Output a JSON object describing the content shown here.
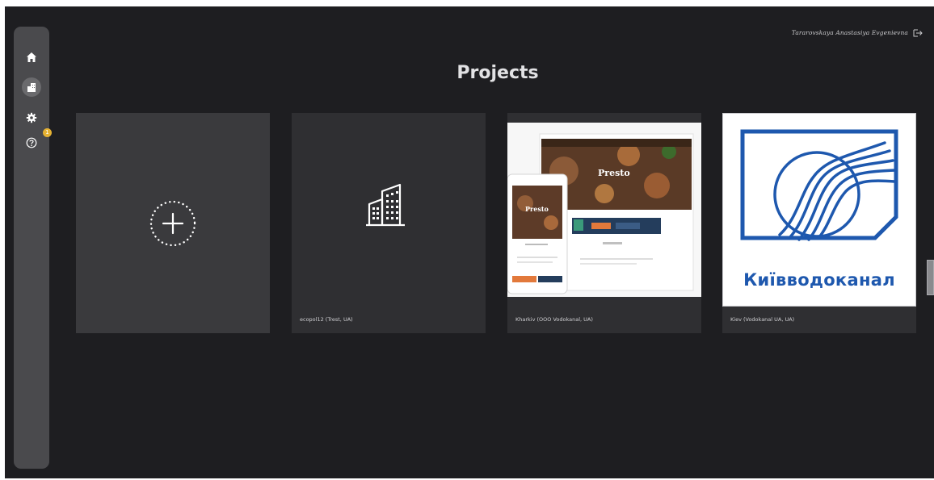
{
  "header": {
    "user_name": "Tararovskaya Anastasiya Evgenievna",
    "logout_icon": "logout-icon"
  },
  "sidebar": {
    "items": [
      {
        "name": "home",
        "icon": "home-icon"
      },
      {
        "name": "projects",
        "icon": "building-icon",
        "active": true
      },
      {
        "name": "settings",
        "icon": "gear-icon"
      },
      {
        "name": "help",
        "icon": "help-icon",
        "badge": "1"
      }
    ]
  },
  "main": {
    "title": "Projects",
    "cards": [
      {
        "type": "new",
        "icon": "add-circle-icon",
        "label": ""
      },
      {
        "type": "project",
        "icon": "building-icon",
        "label": "ecopol12 (Trest, UA)"
      },
      {
        "type": "project",
        "icon": "website-preview-image",
        "label": "Kharkiv (OOO Vodokanal, UA)",
        "thumb_text": "Presto"
      },
      {
        "type": "project",
        "icon": "kyivvodokanal-logo",
        "label": "Kiev (Vodokanal UA, UA)",
        "thumb_text": "Київводоканал"
      }
    ]
  },
  "colors": {
    "background": "#1e1e21",
    "sidebar": "#4a4a4d",
    "card": "#2f2f32",
    "badge": "#e6b233",
    "logo_blue": "#1e58ae"
  }
}
